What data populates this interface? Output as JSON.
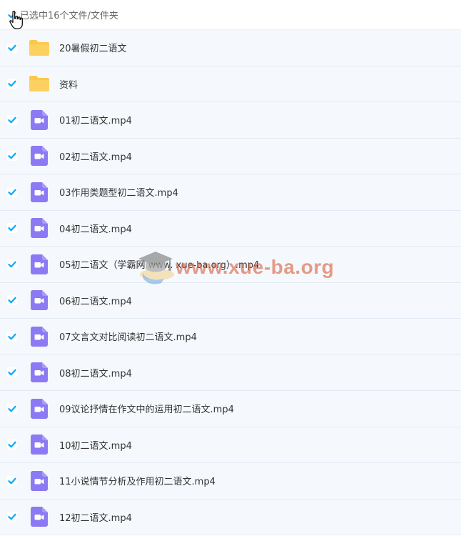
{
  "header": {
    "selection_text": "已选中16个文件/文件夹"
  },
  "rows": [
    {
      "name": "20暑假初二语文",
      "icon": "folder-icon"
    },
    {
      "name": "资料",
      "icon": "folder-icon"
    },
    {
      "name": "01初二语文.mp4",
      "icon": "video-file-icon"
    },
    {
      "name": "02初二语文.mp4",
      "icon": "video-file-icon"
    },
    {
      "name": "03作用类题型初二语文.mp4",
      "icon": "video-file-icon"
    },
    {
      "name": "04初二语文.mp4",
      "icon": "video-file-icon"
    },
    {
      "name": "05初二语文（学霸网 www. xue-ba.org）.mp4",
      "icon": "video-file-icon"
    },
    {
      "name": "06初二语文.mp4",
      "icon": "video-file-icon"
    },
    {
      "name": "07文言文对比阅读初二语文.mp4",
      "icon": "video-file-icon"
    },
    {
      "name": "08初二语文.mp4",
      "icon": "video-file-icon"
    },
    {
      "name": "09议论抒情在作文中的运用初二语文.mp4",
      "icon": "video-file-icon"
    },
    {
      "name": "10初二语文.mp4",
      "icon": "video-file-icon"
    },
    {
      "name": "11小说情节分析及作用初二语文.mp4",
      "icon": "video-file-icon"
    },
    {
      "name": "12初二语文.mp4",
      "icon": "video-file-icon"
    }
  ],
  "watermark": {
    "text": "www.xue-ba.org"
  },
  "colors": {
    "check": "#06a7ff",
    "folder": "#fcc84a",
    "video": "#8b7af3",
    "row_bg": "#f5f9fe",
    "row_border": "#e2ebf5"
  }
}
